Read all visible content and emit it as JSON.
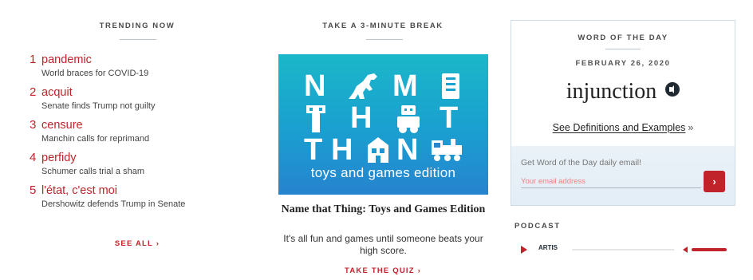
{
  "trending": {
    "heading": "TRENDING NOW",
    "items": [
      {
        "num": "1",
        "word": "pandemic",
        "desc": "World braces for COVID-19"
      },
      {
        "num": "2",
        "word": "acquit",
        "desc": "Senate finds Trump not guilty"
      },
      {
        "num": "3",
        "word": "censure",
        "desc": "Manchin calls for reprimand"
      },
      {
        "num": "4",
        "word": "perfidy",
        "desc": "Schumer calls trial a sham"
      },
      {
        "num": "5",
        "word": "l'état, c'est moi",
        "desc": "Dershowitz defends Trump in Senate"
      }
    ],
    "see_all": "SEE ALL ›"
  },
  "break": {
    "heading": "TAKE A 3-MINUTE BREAK",
    "image_logo_text": [
      "N",
      "M",
      "T",
      "H",
      "T",
      "T",
      "H",
      "N"
    ],
    "image_subtitle": "toys and games edition",
    "title": "Name that Thing: Toys and Games Edition",
    "description": "It's all fun and games until someone beats your high score.",
    "cta": "TAKE THE QUIZ ›"
  },
  "wotd": {
    "heading": "WORD OF THE DAY",
    "date": "FEBRUARY 26, 2020",
    "word": "injunction",
    "see_defs": "See Definitions and Examples",
    "see_defs_arrow": "»",
    "email_label": "Get Word of the Day daily email!",
    "email_placeholder": "Your email address",
    "submit_label": "›"
  },
  "podcast": {
    "heading": "PODCAST",
    "logo": "ARTIS",
    "progress": 0.0
  },
  "colors": {
    "accent": "#c0242a",
    "promo_top": "#1bb7c9",
    "promo_bottom": "#2683cf"
  }
}
